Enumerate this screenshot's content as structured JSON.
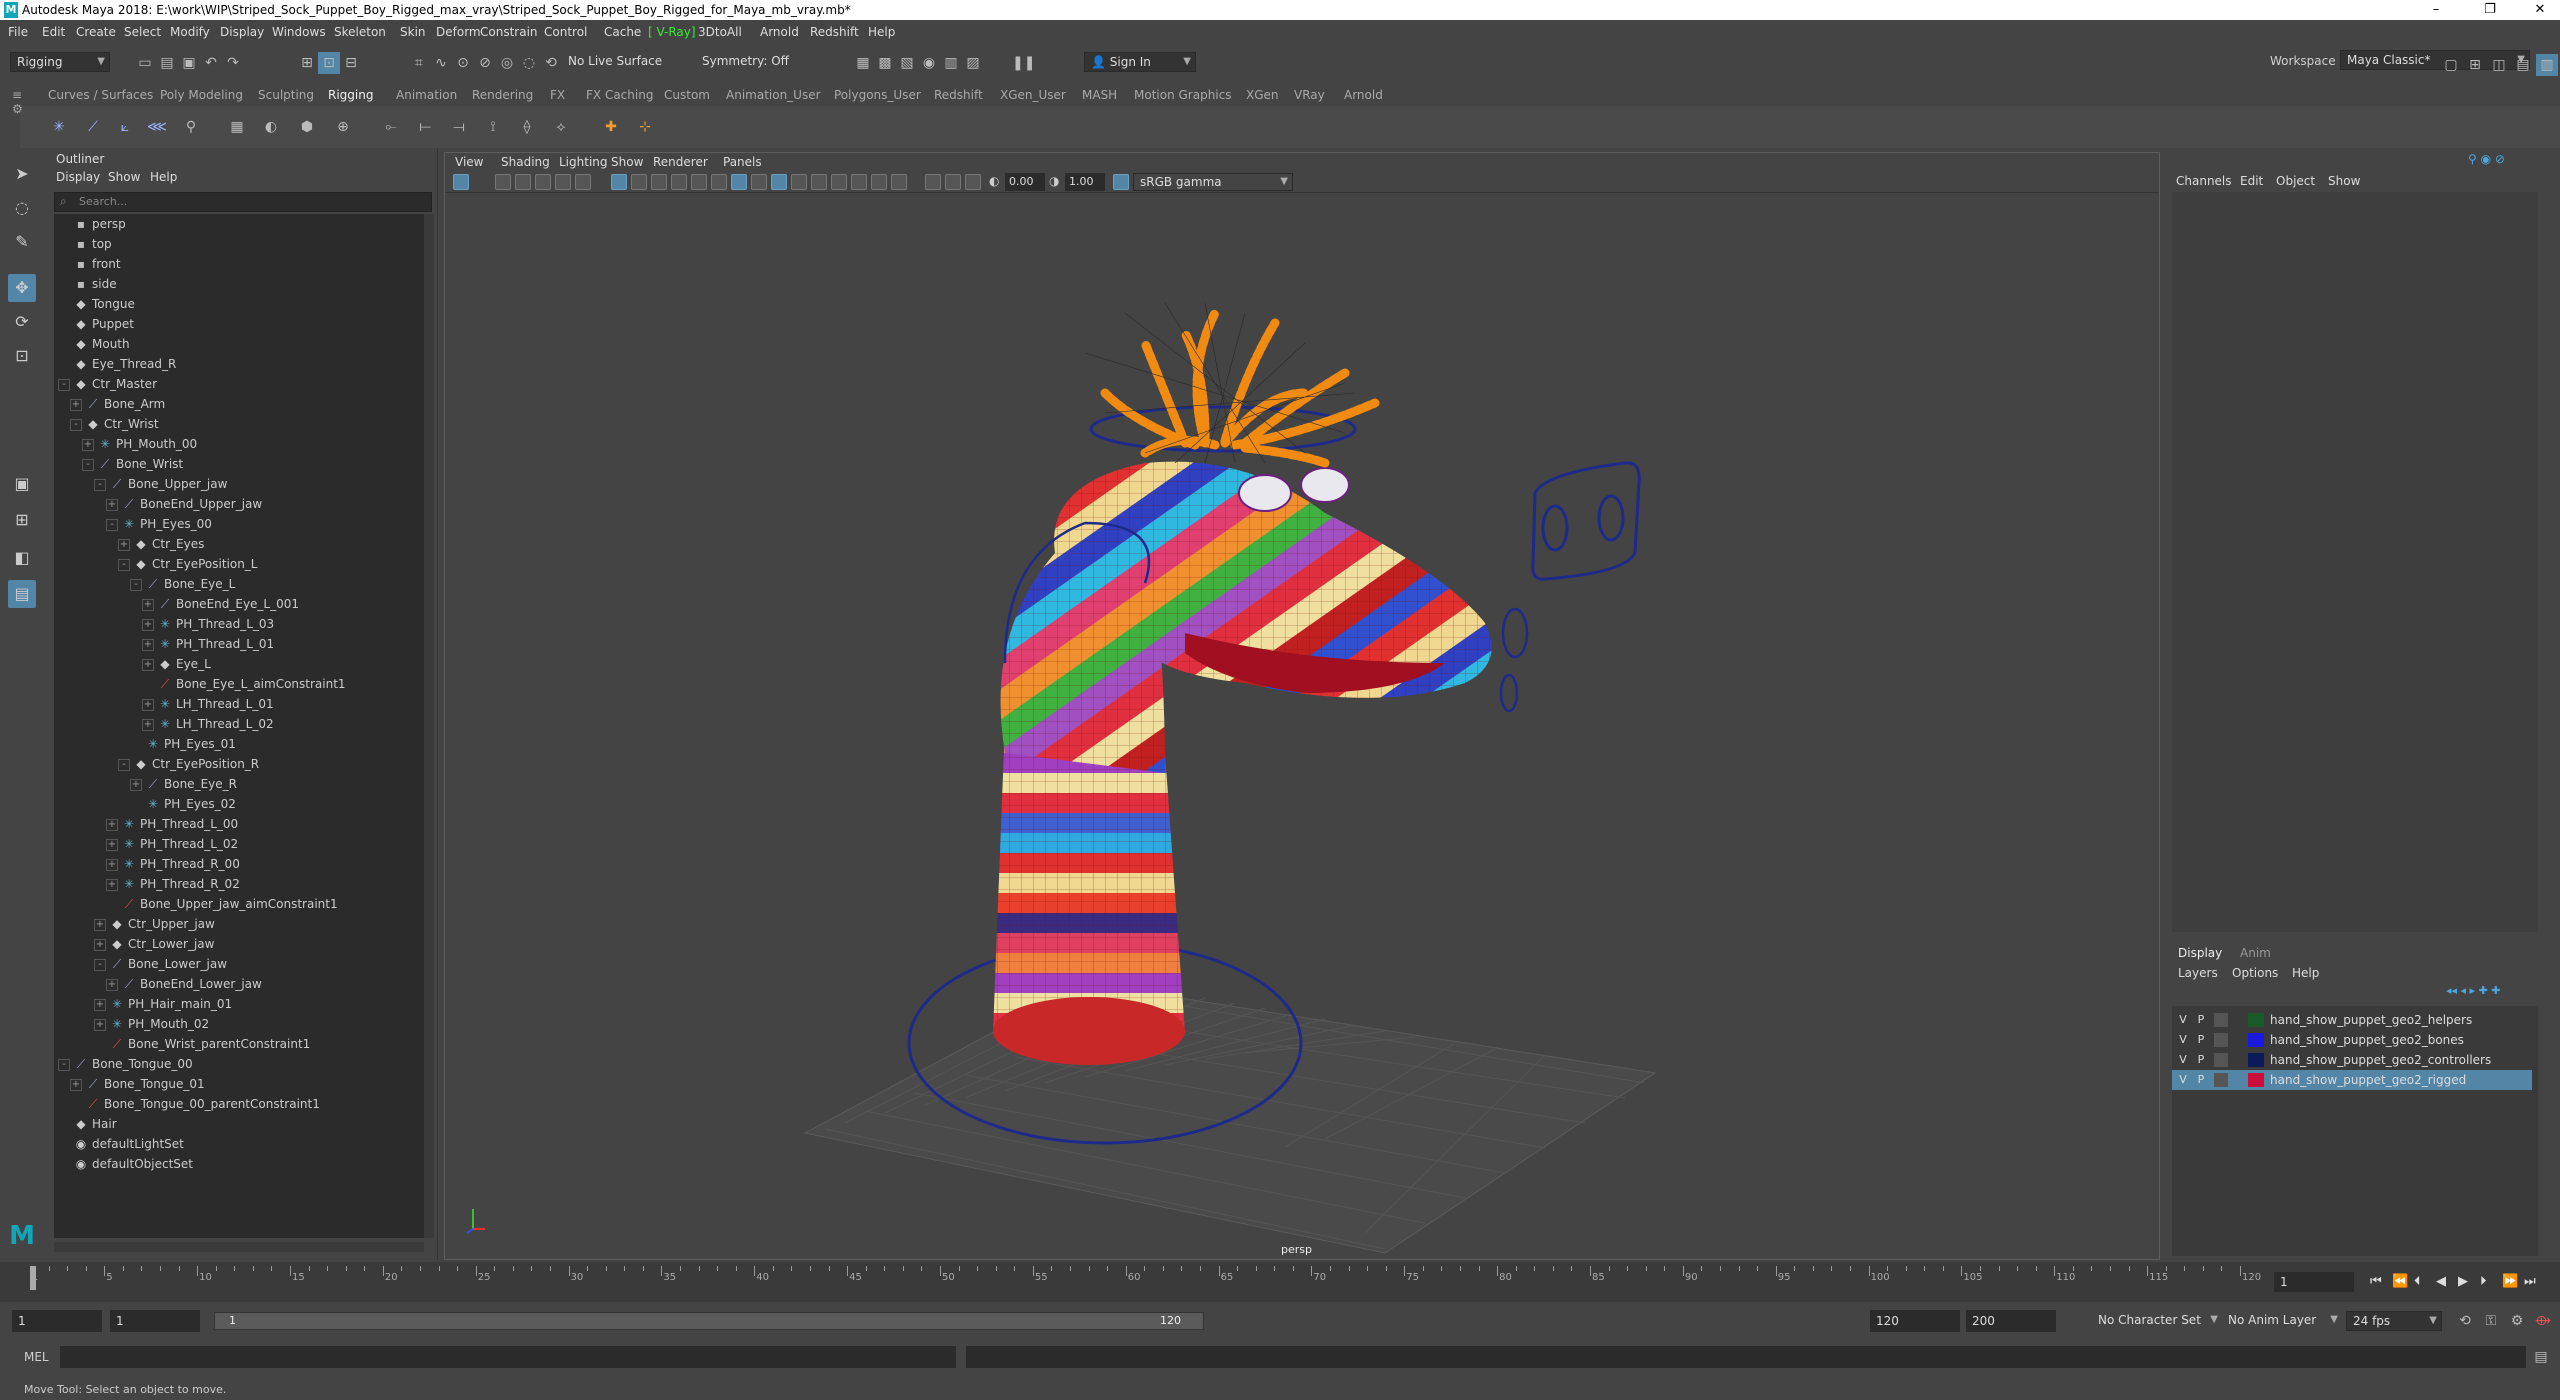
{
  "window": {
    "title": "Autodesk Maya 2018: E:\\work\\WIP\\Striped_Sock_Puppet_Boy_Rigged_max_vray\\Striped_Sock_Puppet_Boy_Rigged_for_Maya_mb_vray.mb*",
    "logo": "M"
  },
  "menubar": [
    "File",
    "Edit",
    "Create",
    "Select",
    "Modify",
    "Display",
    "Windows",
    "Skeleton",
    "Skin",
    "Deform",
    "Constrain",
    "Control",
    "Cache",
    "V-Ray",
    "3DtoAll",
    "Arnold",
    "Redshift",
    "Help"
  ],
  "vray_bracket": "[ V-Ray]",
  "workspace": {
    "label": "Workspace :",
    "value": "Maya Classic*"
  },
  "status": {
    "mode": "Rigging",
    "live_surface": "No Live Surface",
    "symmetry": "Symmetry: Off",
    "sign_in": "Sign In"
  },
  "shelf_tabs": [
    "Curves / Surfaces",
    "Poly Modeling",
    "Sculpting",
    "Rigging",
    "Animation",
    "Rendering",
    "FX",
    "FX Caching",
    "Custom",
    "Animation_User",
    "Polygons_User",
    "Redshift",
    "XGen_User",
    "MASH",
    "Motion Graphics",
    "XGen",
    "VRay",
    "Arnold"
  ],
  "active_shelf": "Rigging",
  "outliner": {
    "title": "Outliner",
    "menus": [
      "Display",
      "Show",
      "Help"
    ],
    "search_placeholder": "Search...",
    "nodes": [
      {
        "label": "persp",
        "depth": 0,
        "icon": "cam",
        "exp": ""
      },
      {
        "label": "top",
        "depth": 0,
        "icon": "cam",
        "exp": ""
      },
      {
        "label": "front",
        "depth": 0,
        "icon": "cam",
        "exp": ""
      },
      {
        "label": "side",
        "depth": 0,
        "icon": "cam",
        "exp": ""
      },
      {
        "label": "Tongue",
        "depth": 0,
        "icon": "tf",
        "exp": ""
      },
      {
        "label": "Puppet",
        "depth": 0,
        "icon": "tf",
        "exp": ""
      },
      {
        "label": "Mouth",
        "depth": 0,
        "icon": "tf",
        "exp": ""
      },
      {
        "label": "Eye_Thread_R",
        "depth": 0,
        "icon": "tf",
        "exp": ""
      },
      {
        "label": "Ctr_Master",
        "depth": 0,
        "icon": "tf",
        "exp": "-"
      },
      {
        "label": "Bone_Arm",
        "depth": 1,
        "icon": "jnt",
        "exp": "+"
      },
      {
        "label": "Ctr_Wrist",
        "depth": 1,
        "icon": "tf",
        "exp": "-"
      },
      {
        "label": "PH_Mouth_00",
        "depth": 2,
        "icon": "loc",
        "exp": "+"
      },
      {
        "label": "Bone_Wrist",
        "depth": 2,
        "icon": "jnt",
        "exp": "-"
      },
      {
        "label": "Bone_Upper_jaw",
        "depth": 3,
        "icon": "jnt",
        "exp": "-"
      },
      {
        "label": "BoneEnd_Upper_jaw",
        "depth": 4,
        "icon": "jnt",
        "exp": "+"
      },
      {
        "label": "PH_Eyes_00",
        "depth": 4,
        "icon": "loc",
        "exp": "-"
      },
      {
        "label": "Ctr_Eyes",
        "depth": 5,
        "icon": "tf",
        "exp": "+"
      },
      {
        "label": "Ctr_EyePosition_L",
        "depth": 5,
        "icon": "tf",
        "exp": "-"
      },
      {
        "label": "Bone_Eye_L",
        "depth": 6,
        "icon": "jnt",
        "exp": "-"
      },
      {
        "label": "BoneEnd_Eye_L_001",
        "depth": 7,
        "icon": "jnt",
        "exp": "+"
      },
      {
        "label": "PH_Thread_L_03",
        "depth": 7,
        "icon": "loc",
        "exp": "+"
      },
      {
        "label": "PH_Thread_L_01",
        "depth": 7,
        "icon": "loc",
        "exp": "+"
      },
      {
        "label": "Eye_L",
        "depth": 7,
        "icon": "tf",
        "exp": "+"
      },
      {
        "label": "Bone_Eye_L_aimConstraint1",
        "depth": 7,
        "icon": "con",
        "exp": ""
      },
      {
        "label": "LH_Thread_L_01",
        "depth": 7,
        "icon": "loc",
        "exp": "+"
      },
      {
        "label": "LH_Thread_L_02",
        "depth": 7,
        "icon": "loc",
        "exp": "+"
      },
      {
        "label": "PH_Eyes_01",
        "depth": 6,
        "icon": "loc",
        "exp": ""
      },
      {
        "label": "Ctr_EyePosition_R",
        "depth": 5,
        "icon": "tf",
        "exp": "-"
      },
      {
        "label": "Bone_Eye_R",
        "depth": 6,
        "icon": "jnt",
        "exp": "+"
      },
      {
        "label": "PH_Eyes_02",
        "depth": 6,
        "icon": "loc",
        "exp": ""
      },
      {
        "label": "PH_Thread_L_00",
        "depth": 4,
        "icon": "loc",
        "exp": "+"
      },
      {
        "label": "PH_Thread_L_02",
        "depth": 4,
        "icon": "loc",
        "exp": "+"
      },
      {
        "label": "PH_Thread_R_00",
        "depth": 4,
        "icon": "loc",
        "exp": "+"
      },
      {
        "label": "PH_Thread_R_02",
        "depth": 4,
        "icon": "loc",
        "exp": "+"
      },
      {
        "label": "Bone_Upper_jaw_aimConstraint1",
        "depth": 4,
        "icon": "con",
        "exp": ""
      },
      {
        "label": "Ctr_Upper_jaw",
        "depth": 3,
        "icon": "tf",
        "exp": "+"
      },
      {
        "label": "Ctr_Lower_jaw",
        "depth": 3,
        "icon": "tf",
        "exp": "+"
      },
      {
        "label": "Bone_Lower_jaw",
        "depth": 3,
        "icon": "jnt",
        "exp": "-"
      },
      {
        "label": "BoneEnd_Lower_jaw",
        "depth": 4,
        "icon": "jnt",
        "exp": "+"
      },
      {
        "label": "PH_Hair_main_01",
        "depth": 3,
        "icon": "loc",
        "exp": "+"
      },
      {
        "label": "PH_Mouth_02",
        "depth": 3,
        "icon": "loc",
        "exp": "+"
      },
      {
        "label": "Bone_Wrist_parentConstraint1",
        "depth": 3,
        "icon": "con",
        "exp": ""
      },
      {
        "label": "Bone_Tongue_00",
        "depth": 0,
        "icon": "jnt",
        "exp": "-"
      },
      {
        "label": "Bone_Tongue_01",
        "depth": 1,
        "icon": "jnt",
        "exp": "+"
      },
      {
        "label": "Bone_Tongue_00_parentConstraint1",
        "depth": 1,
        "icon": "con",
        "exp": ""
      },
      {
        "label": "Hair",
        "depth": 0,
        "icon": "tf",
        "exp": ""
      },
      {
        "label": "defaultLightSet",
        "depth": 0,
        "icon": "set",
        "exp": ""
      },
      {
        "label": "defaultObjectSet",
        "depth": 0,
        "icon": "set",
        "exp": ""
      }
    ]
  },
  "viewport": {
    "menus": [
      "View",
      "Shading",
      "Lighting",
      "Show",
      "Renderer",
      "Panels"
    ],
    "exposure": "0.00",
    "gamma": "1.00",
    "color_space": "sRGB gamma",
    "camera_label": "persp"
  },
  "channel_box": {
    "menus": [
      "Channels",
      "Edit",
      "Object",
      "Show"
    ]
  },
  "layer_editor": {
    "tabs": [
      "Display",
      "Anim"
    ],
    "menus": [
      "Layers",
      "Options",
      "Help"
    ],
    "layers": [
      {
        "v": "V",
        "p": "P",
        "name": "hand_show_puppet_geo2_helpers",
        "color": "#1a5a2a",
        "selected": false
      },
      {
        "v": "V",
        "p": "P",
        "name": "hand_show_puppet_geo2_bones",
        "color": "#1a1ae0",
        "selected": false
      },
      {
        "v": "V",
        "p": "P",
        "name": "hand_show_puppet_geo2_controllers",
        "color": "#0c1a5a",
        "selected": false
      },
      {
        "v": "V",
        "p": "P",
        "name": "hand_show_puppet_geo2_rigged",
        "color": "#c8103a",
        "selected": true
      }
    ]
  },
  "timeline": {
    "labels": [
      "1",
      "5",
      "10",
      "15",
      "20",
      "25",
      "30",
      "35",
      "40",
      "45",
      "50",
      "55",
      "60",
      "65",
      "70",
      "75",
      "80",
      "85",
      "90",
      "95",
      "100",
      "105",
      "110",
      "115",
      "120"
    ],
    "current_frame": "1"
  },
  "range": {
    "start": "1",
    "playback_start": "1",
    "range_start_val": "1",
    "range_end_val": "120",
    "playback_end": "120",
    "end": "200",
    "character_set": "No Character Set",
    "anim_layer": "No Anim Layer",
    "fps": "24 fps"
  },
  "command": {
    "label": "MEL"
  },
  "help_line": "Move Tool: Select an object to move."
}
